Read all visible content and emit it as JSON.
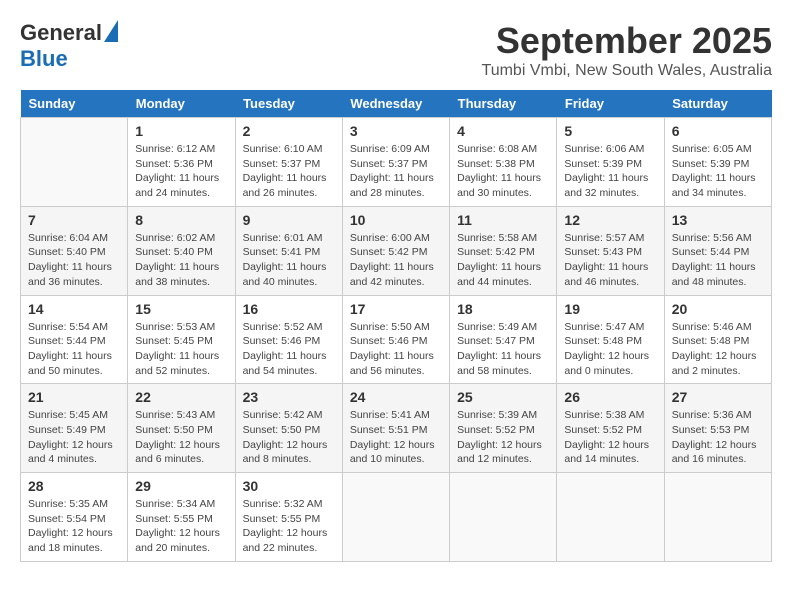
{
  "header": {
    "logo_general": "General",
    "logo_blue": "Blue",
    "month_title": "September 2025",
    "location": "Tumbi Vmbi, New South Wales, Australia"
  },
  "days_of_week": [
    "Sunday",
    "Monday",
    "Tuesday",
    "Wednesday",
    "Thursday",
    "Friday",
    "Saturday"
  ],
  "weeks": [
    [
      {
        "day": "",
        "info": ""
      },
      {
        "day": "1",
        "info": "Sunrise: 6:12 AM\nSunset: 5:36 PM\nDaylight: 11 hours\nand 24 minutes."
      },
      {
        "day": "2",
        "info": "Sunrise: 6:10 AM\nSunset: 5:37 PM\nDaylight: 11 hours\nand 26 minutes."
      },
      {
        "day": "3",
        "info": "Sunrise: 6:09 AM\nSunset: 5:37 PM\nDaylight: 11 hours\nand 28 minutes."
      },
      {
        "day": "4",
        "info": "Sunrise: 6:08 AM\nSunset: 5:38 PM\nDaylight: 11 hours\nand 30 minutes."
      },
      {
        "day": "5",
        "info": "Sunrise: 6:06 AM\nSunset: 5:39 PM\nDaylight: 11 hours\nand 32 minutes."
      },
      {
        "day": "6",
        "info": "Sunrise: 6:05 AM\nSunset: 5:39 PM\nDaylight: 11 hours\nand 34 minutes."
      }
    ],
    [
      {
        "day": "7",
        "info": "Sunrise: 6:04 AM\nSunset: 5:40 PM\nDaylight: 11 hours\nand 36 minutes."
      },
      {
        "day": "8",
        "info": "Sunrise: 6:02 AM\nSunset: 5:40 PM\nDaylight: 11 hours\nand 38 minutes."
      },
      {
        "day": "9",
        "info": "Sunrise: 6:01 AM\nSunset: 5:41 PM\nDaylight: 11 hours\nand 40 minutes."
      },
      {
        "day": "10",
        "info": "Sunrise: 6:00 AM\nSunset: 5:42 PM\nDaylight: 11 hours\nand 42 minutes."
      },
      {
        "day": "11",
        "info": "Sunrise: 5:58 AM\nSunset: 5:42 PM\nDaylight: 11 hours\nand 44 minutes."
      },
      {
        "day": "12",
        "info": "Sunrise: 5:57 AM\nSunset: 5:43 PM\nDaylight: 11 hours\nand 46 minutes."
      },
      {
        "day": "13",
        "info": "Sunrise: 5:56 AM\nSunset: 5:44 PM\nDaylight: 11 hours\nand 48 minutes."
      }
    ],
    [
      {
        "day": "14",
        "info": "Sunrise: 5:54 AM\nSunset: 5:44 PM\nDaylight: 11 hours\nand 50 minutes."
      },
      {
        "day": "15",
        "info": "Sunrise: 5:53 AM\nSunset: 5:45 PM\nDaylight: 11 hours\nand 52 minutes."
      },
      {
        "day": "16",
        "info": "Sunrise: 5:52 AM\nSunset: 5:46 PM\nDaylight: 11 hours\nand 54 minutes."
      },
      {
        "day": "17",
        "info": "Sunrise: 5:50 AM\nSunset: 5:46 PM\nDaylight: 11 hours\nand 56 minutes."
      },
      {
        "day": "18",
        "info": "Sunrise: 5:49 AM\nSunset: 5:47 PM\nDaylight: 11 hours\nand 58 minutes."
      },
      {
        "day": "19",
        "info": "Sunrise: 5:47 AM\nSunset: 5:48 PM\nDaylight: 12 hours\nand 0 minutes."
      },
      {
        "day": "20",
        "info": "Sunrise: 5:46 AM\nSunset: 5:48 PM\nDaylight: 12 hours\nand 2 minutes."
      }
    ],
    [
      {
        "day": "21",
        "info": "Sunrise: 5:45 AM\nSunset: 5:49 PM\nDaylight: 12 hours\nand 4 minutes."
      },
      {
        "day": "22",
        "info": "Sunrise: 5:43 AM\nSunset: 5:50 PM\nDaylight: 12 hours\nand 6 minutes."
      },
      {
        "day": "23",
        "info": "Sunrise: 5:42 AM\nSunset: 5:50 PM\nDaylight: 12 hours\nand 8 minutes."
      },
      {
        "day": "24",
        "info": "Sunrise: 5:41 AM\nSunset: 5:51 PM\nDaylight: 12 hours\nand 10 minutes."
      },
      {
        "day": "25",
        "info": "Sunrise: 5:39 AM\nSunset: 5:52 PM\nDaylight: 12 hours\nand 12 minutes."
      },
      {
        "day": "26",
        "info": "Sunrise: 5:38 AM\nSunset: 5:52 PM\nDaylight: 12 hours\nand 14 minutes."
      },
      {
        "day": "27",
        "info": "Sunrise: 5:36 AM\nSunset: 5:53 PM\nDaylight: 12 hours\nand 16 minutes."
      }
    ],
    [
      {
        "day": "28",
        "info": "Sunrise: 5:35 AM\nSunset: 5:54 PM\nDaylight: 12 hours\nand 18 minutes."
      },
      {
        "day": "29",
        "info": "Sunrise: 5:34 AM\nSunset: 5:55 PM\nDaylight: 12 hours\nand 20 minutes."
      },
      {
        "day": "30",
        "info": "Sunrise: 5:32 AM\nSunset: 5:55 PM\nDaylight: 12 hours\nand 22 minutes."
      },
      {
        "day": "",
        "info": ""
      },
      {
        "day": "",
        "info": ""
      },
      {
        "day": "",
        "info": ""
      },
      {
        "day": "",
        "info": ""
      }
    ]
  ]
}
